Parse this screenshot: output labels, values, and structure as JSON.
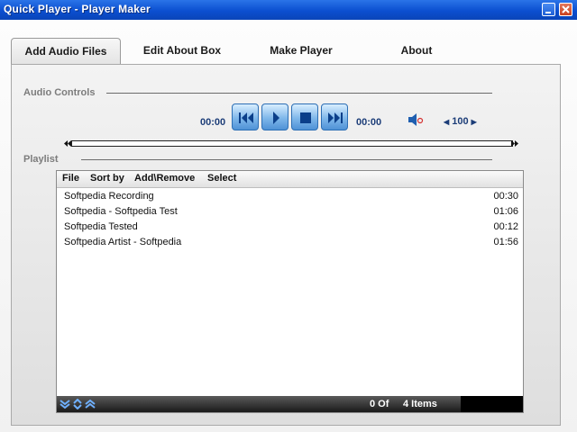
{
  "window": {
    "title": "Quick Player - Player Maker"
  },
  "tabs": [
    {
      "label": "Add Audio Files",
      "active": true
    },
    {
      "label": "Edit About Box",
      "active": false
    },
    {
      "label": "Make Player",
      "active": false
    },
    {
      "label": "About",
      "active": false
    }
  ],
  "audio": {
    "section_label": "Audio Controls",
    "elapsed": "00:00",
    "total": "00:00",
    "volume": "100",
    "seek_progress": 0
  },
  "playlist": {
    "section_label": "Playlist",
    "menu": [
      "File",
      "Sort by",
      "Add\\Remove",
      "Select"
    ],
    "items": [
      {
        "name": "Softpedia Recording",
        "duration": "00:30"
      },
      {
        "name": "Softpedia - Softpedia Test",
        "duration": "01:06"
      },
      {
        "name": "Softpedia Tested",
        "duration": "00:12"
      },
      {
        "name": "Softpedia Artist - Softpedia",
        "duration": "01:56"
      }
    ],
    "footer": {
      "position": "0 Of",
      "count": "4 Items"
    }
  },
  "colors": {
    "accent": "#1c3d78",
    "titlebar": "#0b4fd0",
    "control": "#7fb7ea"
  },
  "icons": {
    "volume": "speaker-icon",
    "prev": "skip-back-icon",
    "play": "play-icon",
    "stop": "stop-icon",
    "next": "skip-forward-icon"
  }
}
